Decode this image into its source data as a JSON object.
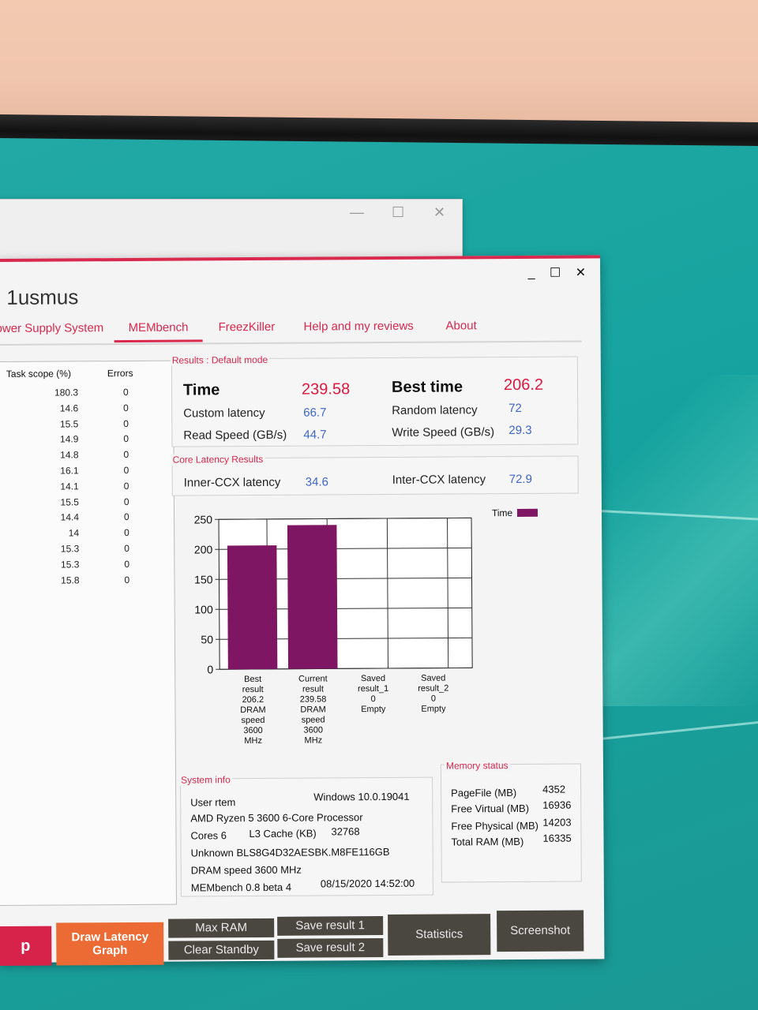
{
  "app": {
    "title": "1usmus",
    "window_controls": {
      "minimize": "_",
      "maximize": "☐",
      "close": "✕"
    },
    "back_window_controls": {
      "minimize": "—",
      "maximize": "☐",
      "close": "✕"
    }
  },
  "tabs": [
    {
      "label": "ower Supply System"
    },
    {
      "label": "MEMbench",
      "active": true
    },
    {
      "label": "FreezKiller"
    },
    {
      "label": "Help and my reviews"
    },
    {
      "label": "About"
    }
  ],
  "task_table": {
    "headers": {
      "scope": "Task scope (%)",
      "errors": "Errors"
    },
    "rows": [
      {
        "scope": "180.3",
        "errors": "0"
      },
      {
        "scope": "14.6",
        "errors": "0"
      },
      {
        "scope": "15.5",
        "errors": "0"
      },
      {
        "scope": "14.9",
        "errors": "0"
      },
      {
        "scope": "14.8",
        "errors": "0"
      },
      {
        "scope": "16.1",
        "errors": "0"
      },
      {
        "scope": "14.1",
        "errors": "0"
      },
      {
        "scope": "15.5",
        "errors": "0"
      },
      {
        "scope": "14.4",
        "errors": "0"
      },
      {
        "scope": "14",
        "errors": "0"
      },
      {
        "scope": "15.3",
        "errors": "0"
      },
      {
        "scope": "15.3",
        "errors": "0"
      },
      {
        "scope": "15.8",
        "errors": "0"
      }
    ]
  },
  "results": {
    "section_label": "Results : Default mode",
    "time_label": "Time",
    "time_value": "239.58",
    "best_time_label": "Best time",
    "best_time_value": "206.2",
    "custom_latency_label": "Custom latency",
    "custom_latency_value": "66.7",
    "random_latency_label": "Random latency",
    "random_latency_value": "72",
    "read_speed_label": "Read Speed (GB/s)",
    "read_speed_value": "44.7",
    "write_speed_label": "Write Speed (GB/s)",
    "write_speed_value": "29.3"
  },
  "core_latency": {
    "section_label": "Core Latency Results",
    "inner_label": "Inner-CCX latency",
    "inner_value": "34.6",
    "inter_label": "Inter-CCX latency",
    "inter_value": "72.9"
  },
  "chart_data": {
    "type": "bar",
    "categories": [
      "Best result",
      "Current result",
      "Saved result_1",
      "Saved result_2"
    ],
    "category_labels": [
      [
        "Best",
        "result",
        "206.2",
        "DRAM",
        "speed",
        "3600",
        "MHz"
      ],
      [
        "Current",
        "result",
        "239.58",
        "DRAM",
        "speed",
        "3600",
        "MHz"
      ],
      [
        "Saved",
        "result_1",
        "0",
        "Empty"
      ],
      [
        "Saved",
        "result_2",
        "0",
        "Empty"
      ]
    ],
    "series": [
      {
        "name": "Time",
        "values": [
          206.2,
          239.58,
          0,
          0
        ]
      }
    ],
    "ylim": [
      0,
      250
    ],
    "yticks": [
      0,
      50,
      100,
      150,
      200,
      250
    ],
    "bar_color": "#7e1663",
    "grid": true,
    "legend_position": "top-right"
  },
  "system_info": {
    "section_label": "System info",
    "user": "User rtem",
    "os": "Windows 10.0.19041",
    "cpu": "AMD Ryzen 5 3600 6-Core Processor",
    "cores": "Cores 6",
    "l3_label": "L3 Cache (KB)",
    "l3_value": "32768",
    "memory_module": "Unknown BLS8G4D32AESBK.M8FE116GB",
    "dram_speed": "DRAM speed 3600 MHz",
    "version": "MEMbench 0.8 beta 4",
    "datetime": "08/15/2020 14:52:00"
  },
  "memory_status": {
    "section_label": "Memory status",
    "items": [
      {
        "label": "PageFile (MB)",
        "value": "4352"
      },
      {
        "label": "Free Virtual (MB)",
        "value": "16936"
      },
      {
        "label": "Free Physical (MB)",
        "value": "14203"
      },
      {
        "label": "Total RAM (MB)",
        "value": "16335"
      }
    ]
  },
  "buttons": {
    "start_partial": "p",
    "draw_latency": "Draw Latency Graph",
    "max_ram": "Max RAM",
    "clear_standby": "Clear Standby",
    "save_result_1": "Save result 1",
    "save_result_2": "Save result 2",
    "statistics": "Statistics",
    "screenshot": "Screenshot"
  },
  "colors": {
    "accent": "#d9294f",
    "value_blue": "#3d66c7",
    "value_red": "#e0163f",
    "button_dark": "#4a4640",
    "button_orange": "#ec6a33"
  }
}
